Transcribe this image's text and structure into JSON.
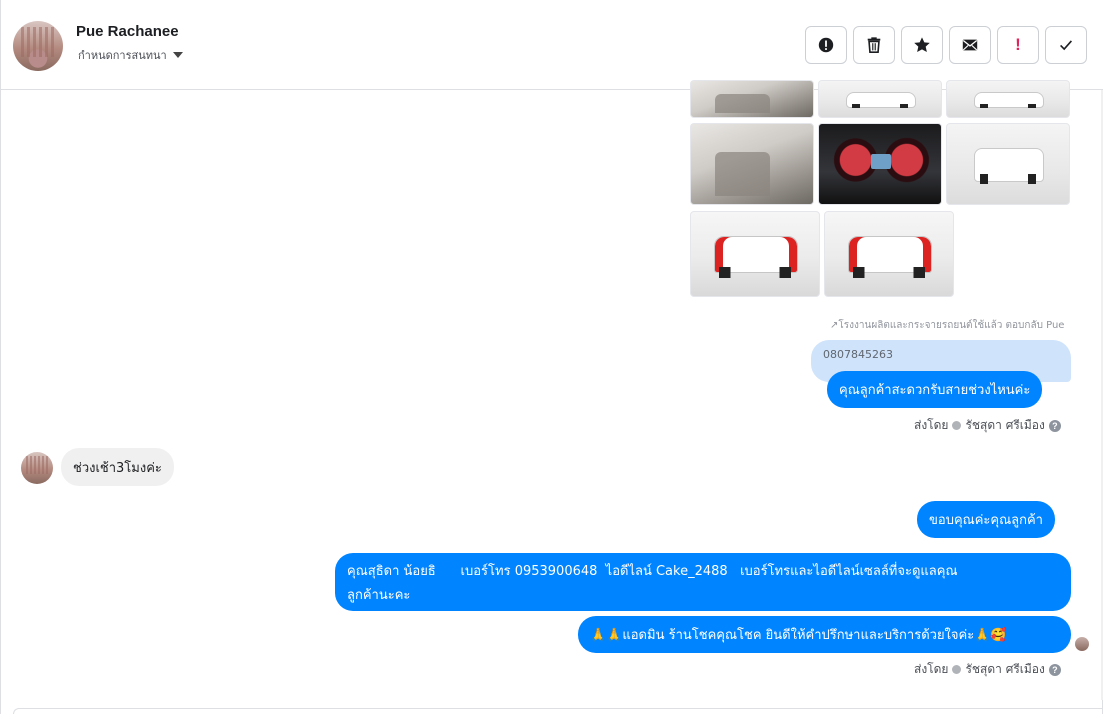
{
  "header": {
    "name": "Pue Rachanee",
    "assign_label": "กำหนดการสนทนา",
    "actions": [
      {
        "name": "report-button",
        "icon": "alert-circle-icon"
      },
      {
        "name": "delete-button",
        "icon": "trash-icon"
      },
      {
        "name": "star-button",
        "icon": "star-icon"
      },
      {
        "name": "mark-unread-button",
        "icon": "envelope-icon"
      },
      {
        "name": "important-button",
        "icon": "exclamation-icon",
        "label": "!"
      },
      {
        "name": "done-button",
        "icon": "check-icon"
      }
    ]
  },
  "photos": [
    {
      "kind": "interior"
    },
    {
      "kind": "white-front"
    },
    {
      "kind": "white-front"
    },
    {
      "kind": "interior"
    },
    {
      "kind": "dashboard"
    },
    {
      "kind": "white-front"
    },
    {
      "kind": "white-rear"
    },
    {
      "kind": "white-rear"
    }
  ],
  "reply_meta": "โรงงานผลิตและกระจายรถยนต์ใช้แล้ว ตอบกลับ Pue",
  "reply_quote": "0807845263",
  "messages": {
    "m1": "คุณลูกค้าสะดวกรับสายช่วงไหนค่ะ",
    "sent_by_label": "ส่งโดย",
    "sender_name": "รัชสุดา ศรีเมือง",
    "incoming": "ช่วงเช้า3โมงค่ะ",
    "m2": "ขอบคุณค่ะคุณลูกค้า",
    "m3_line1": "คุณสุธิดา น้อยธิ      เบอร์โทร 0953900648  ไอดีไลน์ Cake_2488   เบอร์โทรและไอดีไลน์เซลล์ที่จะดูแลคุณ",
    "m3_line2": "ลูกค้านะคะ",
    "m4": "🙏🙏แอดมิน ร้านโชคคุณโชค ยินดีให้คำปรึกษาและบริการด้วยใจค่ะ🙏🥰"
  },
  "colors": {
    "outgoing": "#0084ff",
    "incoming": "#f1f0f0",
    "reply": "#cfe3fb"
  }
}
